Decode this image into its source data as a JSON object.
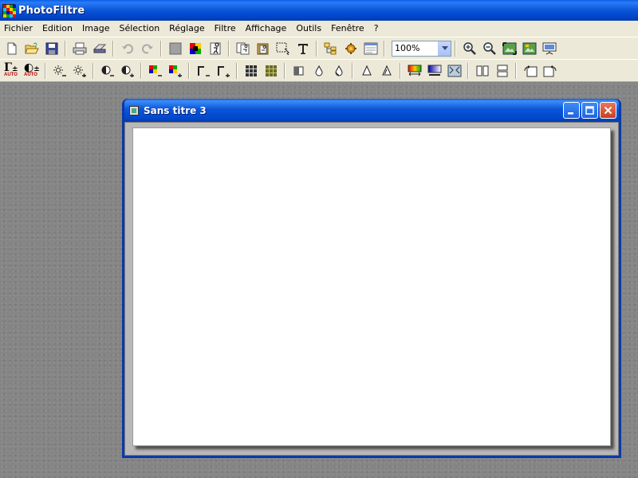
{
  "app": {
    "title": "PhotoFiltre"
  },
  "menu": {
    "items": [
      "Fichier",
      "Edition",
      "Image",
      "Sélection",
      "Réglage",
      "Filtre",
      "Affichage",
      "Outils",
      "Fenêtre",
      "?"
    ]
  },
  "toolbar1": {
    "zoom": "100%",
    "buttons": [
      "new-icon",
      "open-icon",
      "save-icon",
      "print-icon",
      "scan-icon",
      "undo-icon",
      "redo-icon",
      "fill-gray-icon",
      "color-palette-icon",
      "transparency-icon",
      "copy-icon",
      "paste-icon",
      "select-all-icon",
      "text-icon",
      "tree-icon",
      "plugins-icon",
      "window-icon",
      "zoom-in-icon",
      "zoom-out-icon",
      "fit-window-icon",
      "actual-size-icon",
      "slideshow-icon"
    ]
  },
  "toolbar2": {
    "auto_label": "AUTO",
    "buttons": [
      "auto-levels-icon",
      "auto-contrast-icon",
      "brightness-minus-icon",
      "brightness-plus-icon",
      "contrast-minus-icon",
      "contrast-plus-icon",
      "saturation-minus-icon",
      "saturation-plus-icon",
      "gamma-minus-icon",
      "gamma-plus-icon",
      "grid-icon",
      "mosaic-icon",
      "sharpen-icon",
      "blur-icon",
      "blur-more-icon",
      "soften-icon",
      "soften-more-icon",
      "gradient-icon",
      "fade-icon",
      "texture-icon",
      "flip-horizontal-icon",
      "flip-vertical-icon",
      "rotate-left-icon",
      "rotate-right-icon"
    ]
  },
  "document": {
    "title": "Sans titre 3"
  },
  "colors": {
    "titlebar": "#0a55d8",
    "menubar": "#ece9d8",
    "workspace": "#858585",
    "canvas": "#ffffff"
  }
}
